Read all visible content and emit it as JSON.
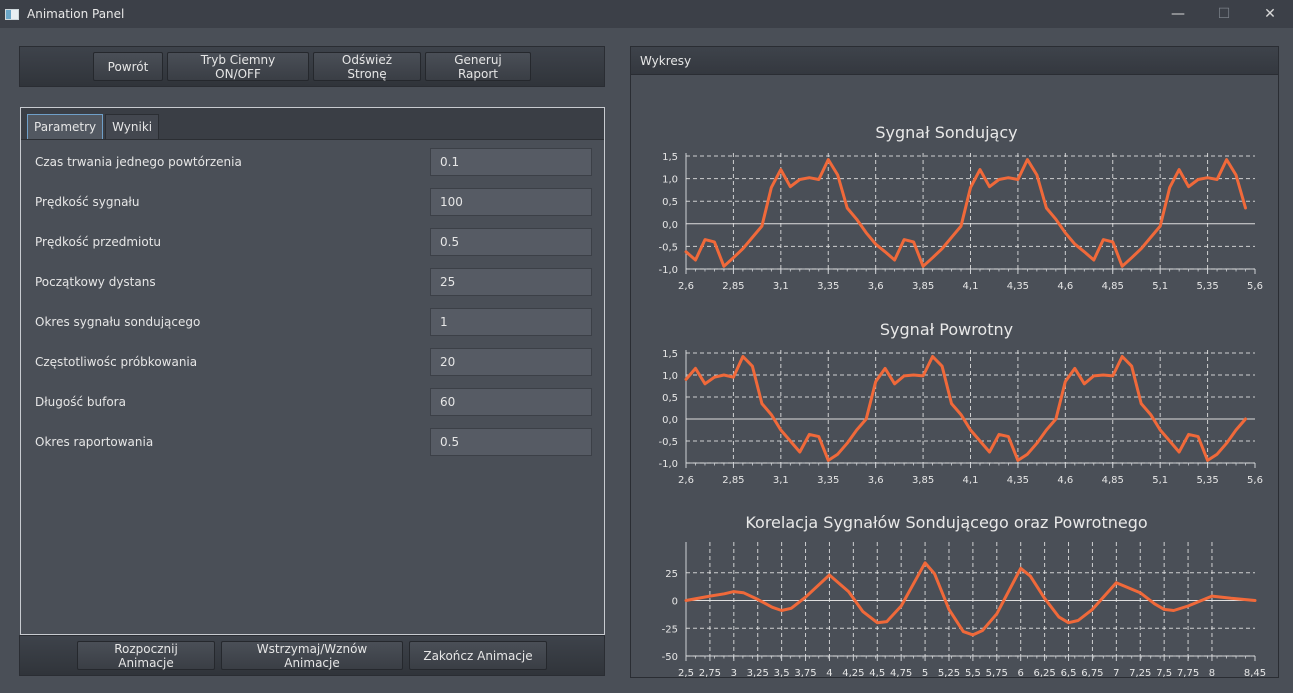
{
  "window": {
    "title": "Animation Panel",
    "controls": {
      "minimize": "—",
      "maximize": "☐",
      "close": "✕"
    }
  },
  "toolbar": {
    "back": "Powrót",
    "dark_mode": "Tryb Ciemny ON/OFF",
    "refresh": "Odśwież Stronę",
    "report": "Generuj Raport"
  },
  "tabs": {
    "params": "Parametry",
    "results": "Wyniki"
  },
  "params": [
    {
      "label": "Czas trwania jednego powtórzenia",
      "value": "0.1"
    },
    {
      "label": "Prędkość sygnału",
      "value": "100"
    },
    {
      "label": "Prędkość przedmiotu",
      "value": "0.5"
    },
    {
      "label": "Początkowy dystans",
      "value": "25"
    },
    {
      "label": "Okres sygnału sondującego",
      "value": "1"
    },
    {
      "label": "Częstotliwośc próbkowania",
      "value": "20"
    },
    {
      "label": "Długość bufora",
      "value": "60"
    },
    {
      "label": "Okres raportowania",
      "value": "0.5"
    }
  ],
  "bottombar": {
    "start": "Rozpocznij Animacje",
    "pause": "Wstrzymaj/Wznów Animacje",
    "stop": "Zakończ Animacje"
  },
  "charts_panel": {
    "title": "Wykresy"
  },
  "colors": {
    "line": "#f0693a",
    "background": "#4a4f57",
    "grid": "#e6e6e6"
  },
  "chart_data": [
    {
      "type": "line",
      "title": "Sygnał Sondujący",
      "xlim": [
        2.6,
        5.6
      ],
      "ylim": [
        -1.0,
        1.5
      ],
      "xticks": [
        "2,6",
        "2,85",
        "3,1",
        "3,35",
        "3,6",
        "3,85",
        "4,1",
        "4,35",
        "4,6",
        "4,85",
        "5,1",
        "5,35",
        "5,6"
      ],
      "yticks": [
        "1,5",
        "1,0",
        "0,5",
        "0,0",
        "-0,5",
        "-1,0"
      ],
      "x": [
        2.6,
        2.65,
        2.7,
        2.75,
        2.8,
        2.85,
        2.9,
        2.95,
        3.0,
        3.05,
        3.1,
        3.15,
        3.2,
        3.25,
        3.3,
        3.35,
        3.4,
        3.45,
        3.5,
        3.55,
        3.6,
        3.65,
        3.7,
        3.75,
        3.8,
        3.85,
        3.9,
        3.95,
        4.0,
        4.05,
        4.1,
        4.15,
        4.2,
        4.25,
        4.3,
        4.35,
        4.4,
        4.45,
        4.5,
        4.55,
        4.6,
        4.65,
        4.7,
        4.75,
        4.8,
        4.85,
        4.9,
        4.95,
        5.0,
        5.05,
        5.1,
        5.15,
        5.2,
        5.25,
        5.3,
        5.35,
        5.4,
        5.45,
        5.5,
        5.55
      ],
      "y": [
        -0.62,
        -0.8,
        -0.35,
        -0.4,
        -0.94,
        -0.75,
        -0.55,
        -0.3,
        -0.05,
        0.8,
        1.2,
        0.82,
        0.98,
        1.02,
        0.98,
        1.42,
        1.08,
        0.35,
        0.1,
        -0.2,
        -0.45,
        -0.62,
        -0.8,
        -0.35,
        -0.4,
        -0.94,
        -0.75,
        -0.55,
        -0.3,
        -0.05,
        0.8,
        1.2,
        0.82,
        0.98,
        1.02,
        0.98,
        1.42,
        1.08,
        0.35,
        0.1,
        -0.2,
        -0.45,
        -0.62,
        -0.8,
        -0.35,
        -0.4,
        -0.94,
        -0.75,
        -0.55,
        -0.3,
        -0.05,
        0.8,
        1.2,
        0.82,
        0.98,
        1.02,
        0.98,
        1.42,
        1.08,
        0.35
      ]
    },
    {
      "type": "line",
      "title": "Sygnał Powrotny",
      "xlim": [
        2.6,
        5.6
      ],
      "ylim": [
        -1.0,
        1.5
      ],
      "xticks": [
        "2,6",
        "2,85",
        "3,1",
        "3,35",
        "3,6",
        "3,85",
        "4,1",
        "4,35",
        "4,6",
        "4,85",
        "5,1",
        "5,35",
        "5,6"
      ],
      "yticks": [
        "1,5",
        "1,0",
        "0,5",
        "0,0",
        "-0,5",
        "-1,0"
      ],
      "x": [
        2.6,
        2.65,
        2.7,
        2.75,
        2.8,
        2.85,
        2.9,
        2.95,
        3.0,
        3.05,
        3.1,
        3.15,
        3.2,
        3.25,
        3.3,
        3.35,
        3.4,
        3.45,
        3.5,
        3.55,
        3.6,
        3.65,
        3.7,
        3.75,
        3.8,
        3.85,
        3.9,
        3.95,
        4.0,
        4.05,
        4.1,
        4.15,
        4.2,
        4.25,
        4.3,
        4.35,
        4.4,
        4.45,
        4.5,
        4.55,
        4.6,
        4.65,
        4.7,
        4.75,
        4.8,
        4.85,
        4.9,
        4.95,
        5.0,
        5.05,
        5.1,
        5.15,
        5.2,
        5.25,
        5.3,
        5.35,
        5.4,
        5.45,
        5.5,
        5.55
      ],
      "y": [
        0.9,
        1.15,
        0.8,
        0.95,
        1.0,
        0.95,
        1.42,
        1.2,
        0.35,
        0.1,
        -0.25,
        -0.5,
        -0.75,
        -0.35,
        -0.4,
        -0.94,
        -0.8,
        -0.55,
        -0.25,
        0.0,
        0.85,
        1.15,
        0.8,
        0.98,
        1.0,
        0.98,
        1.42,
        1.2,
        0.35,
        0.1,
        -0.25,
        -0.5,
        -0.75,
        -0.35,
        -0.4,
        -0.94,
        -0.8,
        -0.55,
        -0.25,
        0.0,
        0.85,
        1.15,
        0.8,
        0.98,
        1.0,
        0.98,
        1.42,
        1.2,
        0.35,
        0.1,
        -0.25,
        -0.5,
        -0.75,
        -0.35,
        -0.4,
        -0.94,
        -0.8,
        -0.55,
        -0.25,
        0.0
      ]
    },
    {
      "type": "line",
      "title": "Korelacja Sygnałów Sondującego oraz Powrotnego",
      "xlim": [
        2.5,
        8.45
      ],
      "ylim": [
        -50,
        50
      ],
      "xticks": [
        "2,5",
        "2,75",
        "3",
        "3,25",
        "3,5",
        "3,75",
        "4",
        "4,25",
        "4,5",
        "4,75",
        "5",
        "5,25",
        "5,5",
        "5,75",
        "6",
        "6,25",
        "6,5",
        "6,75",
        "7",
        "7,25",
        "7,5",
        "7,75",
        "8",
        "8,45"
      ],
      "yticks": [
        "25",
        "0",
        "-25",
        "-50"
      ],
      "x": [
        2.5,
        2.75,
        2.9,
        3.0,
        3.1,
        3.25,
        3.4,
        3.5,
        3.6,
        3.75,
        4.0,
        4.2,
        4.35,
        4.5,
        4.6,
        4.75,
        5.0,
        5.1,
        5.25,
        5.4,
        5.5,
        5.6,
        5.75,
        6.0,
        6.1,
        6.25,
        6.4,
        6.5,
        6.6,
        6.75,
        7.0,
        7.25,
        7.4,
        7.5,
        7.6,
        7.75,
        8.0,
        8.2,
        8.45
      ],
      "y": [
        0,
        4,
        6,
        8,
        7,
        1,
        -6,
        -9,
        -7,
        3,
        23,
        8,
        -10,
        -20,
        -19,
        -5,
        34,
        24,
        -8,
        -28,
        -31,
        -27,
        -12,
        29,
        22,
        2,
        -15,
        -20,
        -18,
        -8,
        16,
        7,
        -3,
        -8,
        -9,
        -5,
        4,
        2,
        0
      ]
    }
  ]
}
